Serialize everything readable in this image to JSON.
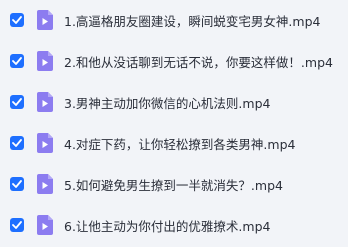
{
  "colors": {
    "checkbox": "#1e6fff",
    "video_icon": "#8c7cf0",
    "row_bg": "#f2f4f8",
    "text": "#2b2f3a"
  },
  "files": [
    {
      "name": "1.高逼格朋友圈建设，瞬间蜕变宅男女神.mp4",
      "checked": true,
      "icon": "video-file-icon"
    },
    {
      "name": "2.和他从没话聊到无话不说，你要这样做！.mp4",
      "checked": true,
      "icon": "video-file-icon"
    },
    {
      "name": "3.男神主动加你微信的心机法则.mp4",
      "checked": true,
      "icon": "video-file-icon"
    },
    {
      "name": "4.对症下药，让你轻松撩到各类男神.mp4",
      "checked": true,
      "icon": "video-file-icon"
    },
    {
      "name": "5.如何避免男生撩到一半就消失？.mp4",
      "checked": true,
      "icon": "video-file-icon"
    },
    {
      "name": "6.让他主动为你付出的优雅撩术.mp4",
      "checked": true,
      "icon": "video-file-icon"
    }
  ]
}
